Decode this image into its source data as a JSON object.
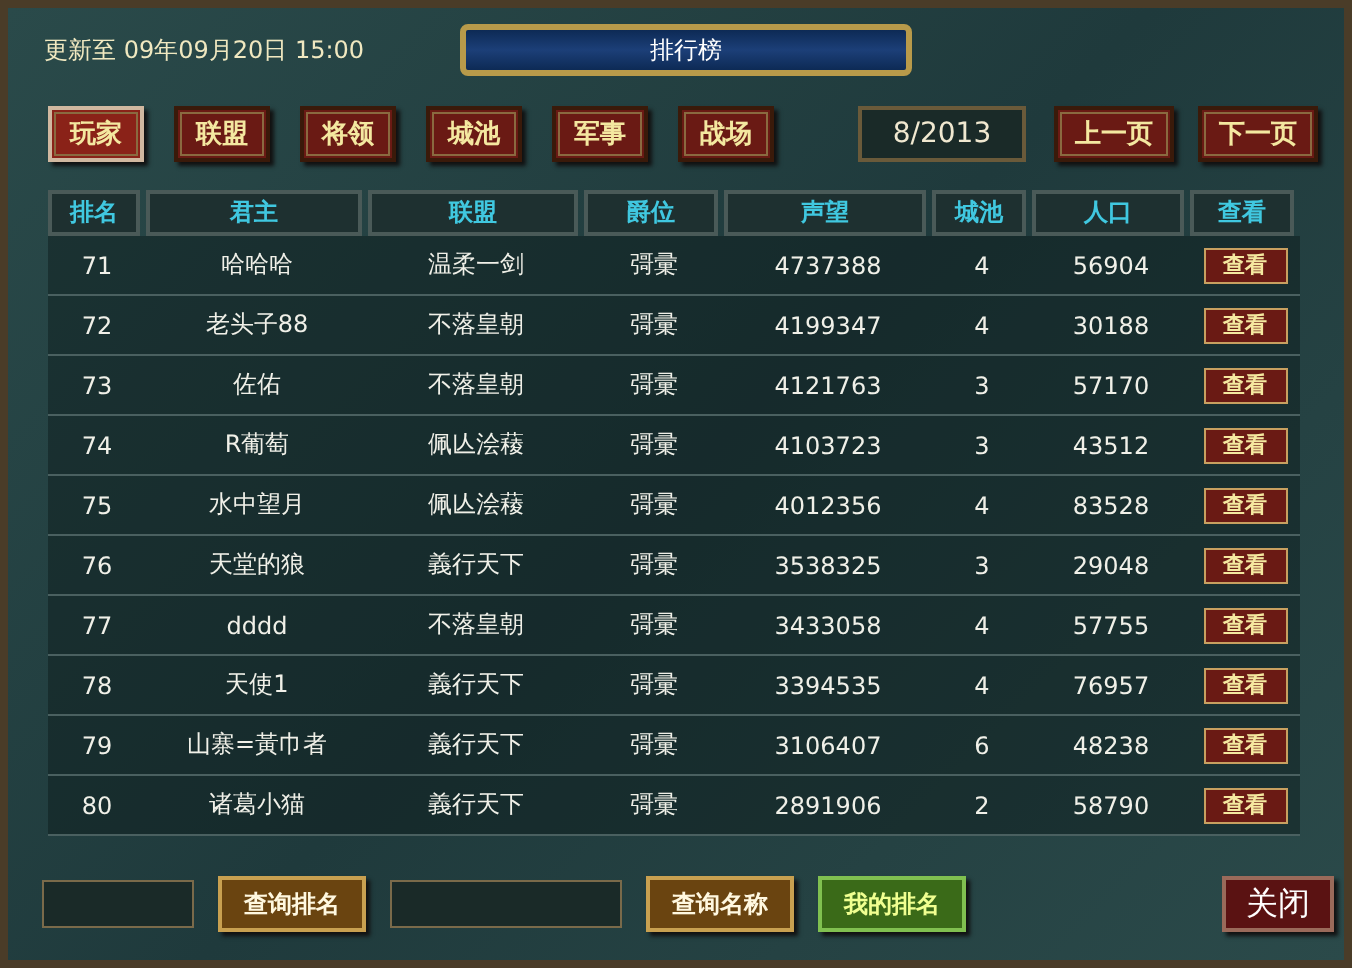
{
  "updated": "更新至 09年09月20日 15:00",
  "title": "排行榜",
  "tabs": [
    {
      "label": "玩家",
      "selected": true
    },
    {
      "label": "联盟",
      "selected": false
    },
    {
      "label": "将领",
      "selected": false
    },
    {
      "label": "城池",
      "selected": false
    },
    {
      "label": "军事",
      "selected": false
    },
    {
      "label": "战场",
      "selected": false
    }
  ],
  "page": "8/2013",
  "pager": [
    "上一页",
    "下一页"
  ],
  "table": {
    "columns": [
      "排名",
      "君主",
      "联盟",
      "爵位",
      "声望",
      "城池",
      "人口",
      "查看"
    ],
    "rows": [
      [
        "71",
        "哈哈哈",
        "温柔一剑",
        "彁彚",
        "4737388",
        "4",
        "56904",
        "查看"
      ],
      [
        "72",
        "老头子88",
        "不落皇朝",
        "彁彚",
        "4199347",
        "4",
        "30188",
        "查看"
      ],
      [
        "73",
        "佐佑",
        "不落皇朝",
        "彁彚",
        "4121763",
        "3",
        "57170",
        "查看"
      ],
      [
        "74",
        "R葡萄",
        "佩亾浍薐",
        "彁彚",
        "4103723",
        "3",
        "43512",
        "查看"
      ],
      [
        "75",
        "水中望月",
        "佩亾浍薐",
        "彁彚",
        "4012356",
        "4",
        "83528",
        "查看"
      ],
      [
        "76",
        "天堂的狼",
        "義行天下",
        "彁彚",
        "3538325",
        "3",
        "29048",
        "查看"
      ],
      [
        "77",
        "dddd",
        "不落皇朝",
        "彁彚",
        "3433058",
        "4",
        "57755",
        "查看"
      ],
      [
        "78",
        "天使1",
        "義行天下",
        "彁彚",
        "3394535",
        "4",
        "76957",
        "查看"
      ],
      [
        "79",
        "山寨=黃巾者",
        "義行天下",
        "彁彚",
        "3106407",
        "6",
        "48238",
        "查看"
      ],
      [
        "80",
        "诸葛小猫",
        "義行天下",
        "彁彚",
        "2891906",
        "2",
        "58790",
        "查看"
      ]
    ]
  },
  "footer": [
    {
      "kind": "field"
    },
    {
      "kind": "gold",
      "label": "查询排名"
    },
    {
      "kind": "field"
    },
    {
      "kind": "gold",
      "label": "查询名称"
    },
    {
      "kind": "green",
      "label": "我的排名"
    }
  ],
  "close": "关闭"
}
